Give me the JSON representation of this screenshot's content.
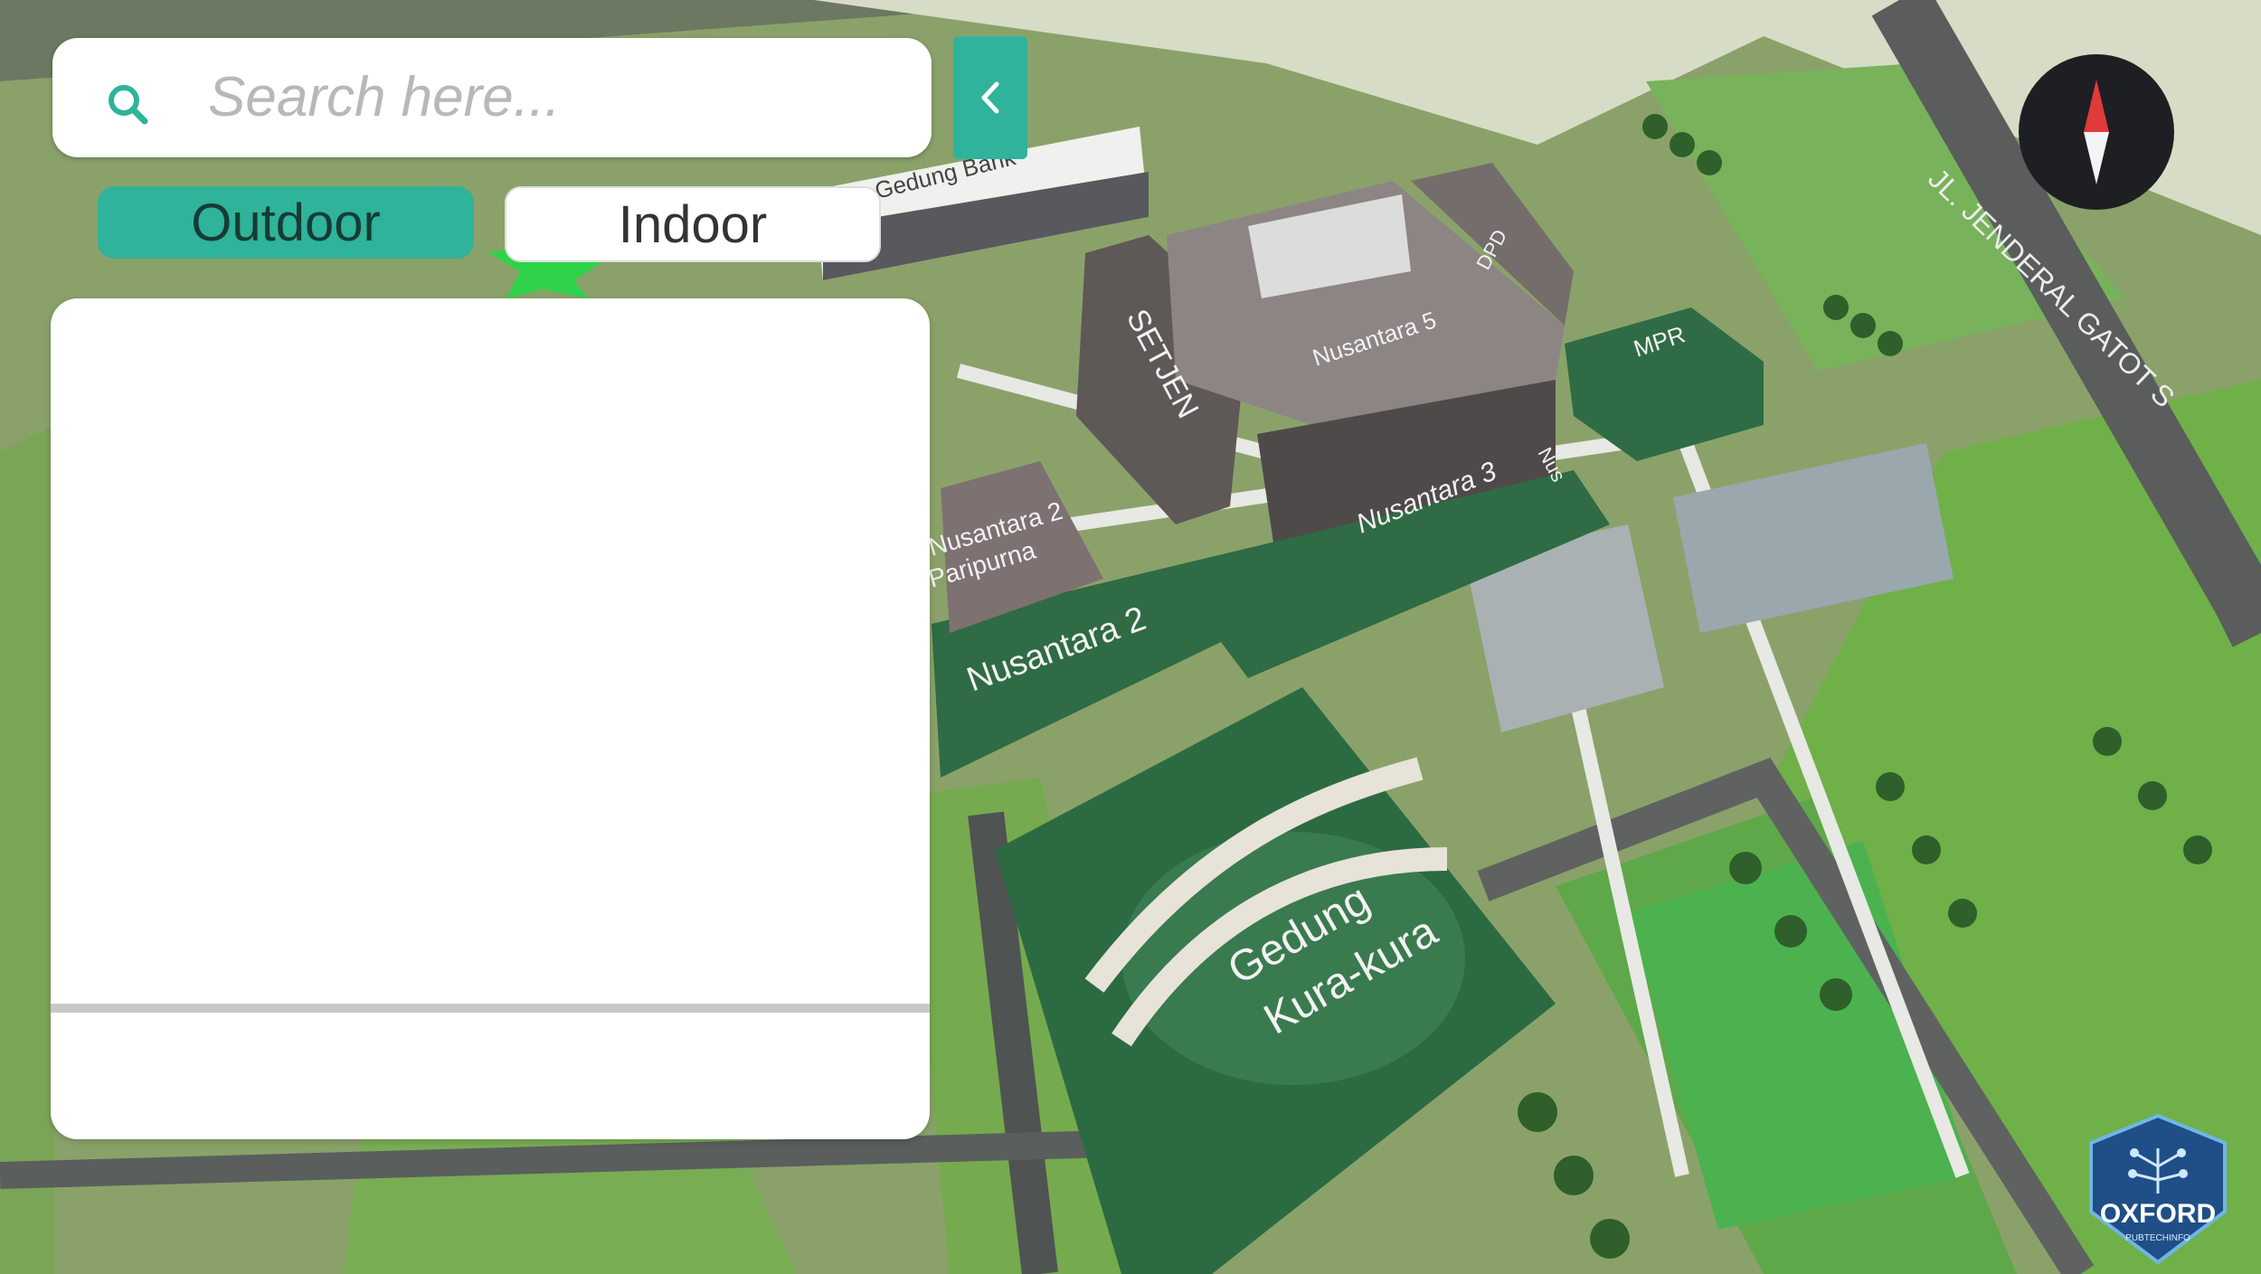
{
  "search": {
    "placeholder": "Search here..."
  },
  "tabs": [
    {
      "label": "Outdoor",
      "active": true
    },
    {
      "label": "Indoor",
      "active": false
    }
  ],
  "colors": {
    "accent": "#2fb39a",
    "panel": "#ffffff",
    "building_green": "#2e6e45"
  },
  "map": {
    "labels": {
      "gedung_bank": "Gedung Bank",
      "setjen": "SETJEN",
      "nusantara5": "Nusantara 5",
      "dpd": "DPD",
      "mpr": "MPR",
      "nusantara3": "Nusantara 3",
      "nusantara2_paripurna": "Nusantara 2",
      "paripurna": "Paripurna",
      "nusantara2": "Nusantara 2",
      "gedung_kura_kura_1": "Gedung",
      "gedung_kura_kura_2": "Kura-kura",
      "street": "JL. JENDERAL GATOT S",
      "nus": "Nus"
    }
  },
  "logo": {
    "name": "OXFORD",
    "tagline": "PUBTECHINFO"
  }
}
